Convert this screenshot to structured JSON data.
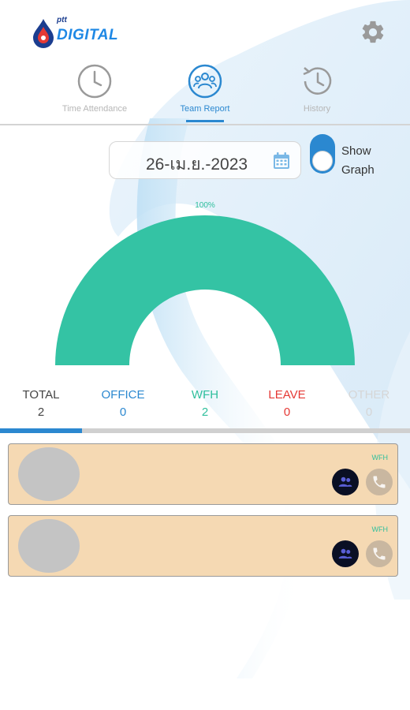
{
  "header": {
    "brand_small": "ptt",
    "brand": "DIGITAL",
    "settings_icon": "gear-icon"
  },
  "tabs": [
    {
      "label": "Time Attendance",
      "icon": "clock-icon",
      "active": false
    },
    {
      "label": "Team Report",
      "icon": "team-icon",
      "active": true
    },
    {
      "label": "History",
      "icon": "history-icon",
      "active": false
    }
  ],
  "date_picker": {
    "value": "26-เม.ย.-2023",
    "icon": "calendar-icon"
  },
  "graph_toggle": {
    "label_line1": "Show",
    "label_line2": "Graph",
    "on": true
  },
  "gauge": {
    "percent_label": "100%",
    "value_fraction": 1.0,
    "color": "#34c3a4"
  },
  "stats": [
    {
      "label": "TOTAL",
      "value": "2",
      "label_color": "#444444",
      "value_color": "#444444"
    },
    {
      "label": "OFFICE",
      "value": "0",
      "label_color": "#2b88d0",
      "value_color": "#2b88d0"
    },
    {
      "label": "WFH",
      "value": "2",
      "label_color": "#2fbf9c",
      "value_color": "#2fbf9c"
    },
    {
      "label": "LEAVE",
      "value": "0",
      "label_color": "#e53935",
      "value_color": "#e53935"
    },
    {
      "label": "OTHER",
      "value": "0",
      "label_color": "#d6d6d6",
      "value_color": "#d6d6d6"
    }
  ],
  "progress": {
    "fraction": 0.2,
    "color": "#2b88d0"
  },
  "members": [
    {
      "status": "WFH"
    },
    {
      "status": "WFH"
    }
  ],
  "colors": {
    "accent": "#2b88d0",
    "card_bg": "#f5d9b3",
    "wfh": "#2fbf9c"
  }
}
